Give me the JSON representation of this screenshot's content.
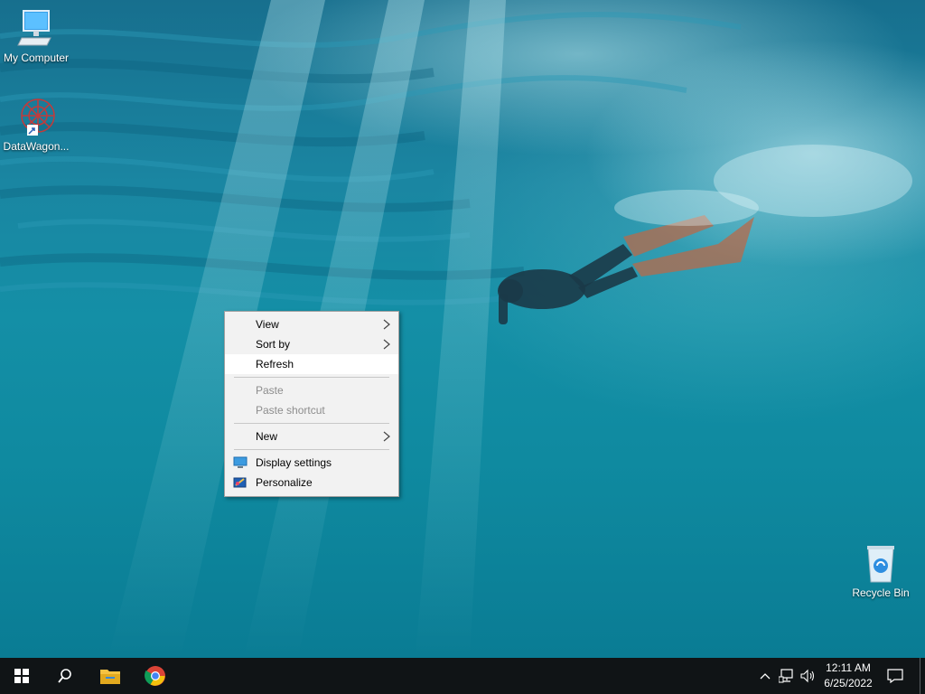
{
  "desktop": {
    "icons": [
      {
        "label": "My Computer",
        "icon": "computer-icon"
      },
      {
        "label": "DataWagon...",
        "icon": "datawagon-icon"
      },
      {
        "label": "Recycle Bin",
        "icon": "recycle-bin-icon"
      }
    ]
  },
  "context_menu": {
    "items": [
      {
        "label": "View",
        "submenu": true
      },
      {
        "label": "Sort by",
        "submenu": true
      },
      {
        "label": "Refresh",
        "state": "hover"
      },
      {
        "label": "Paste",
        "state": "disabled"
      },
      {
        "label": "Paste shortcut",
        "state": "disabled"
      },
      {
        "label": "New",
        "submenu": true
      },
      {
        "label": "Display settings",
        "icon": "display-settings-icon"
      },
      {
        "label": "Personalize",
        "icon": "personalize-icon"
      }
    ]
  },
  "taskbar": {
    "pinned": [
      "start-icon",
      "search-icon",
      "file-explorer-icon",
      "chrome-icon"
    ],
    "tray": [
      "chevron-up-icon",
      "network-icon",
      "volume-icon",
      "notification-icon"
    ],
    "clock": {
      "time": "12:11 AM",
      "date": "6/25/2022"
    }
  },
  "colors": {
    "taskbar": "#101416",
    "menu_background": "#f2f2f2",
    "menu_hover": "#ffffff",
    "disabled_text": "#8d8d8d"
  }
}
